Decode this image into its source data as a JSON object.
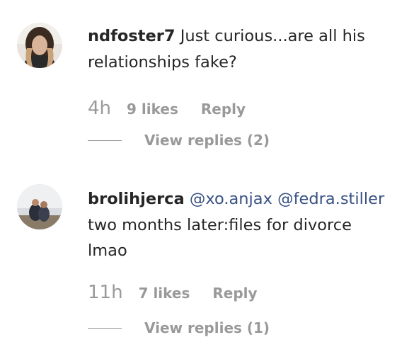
{
  "comments": [
    {
      "username": "ndfoster7",
      "text": "Just curious...are all his relationships fake?",
      "time": "4h",
      "likes": "9 likes",
      "reply_label": "Reply",
      "view_replies": "View replies (2)"
    },
    {
      "username": "brolihjerca",
      "mention1": "@xo.anjax",
      "mention2": "@fedra.stiller",
      "text": "two months later:files for divorce lmao",
      "time": "11h",
      "likes": "7 likes",
      "reply_label": "Reply",
      "view_replies": "View replies (1)"
    }
  ],
  "colors": {
    "text": "#262626",
    "muted": "#999999",
    "mention": "#385185"
  }
}
